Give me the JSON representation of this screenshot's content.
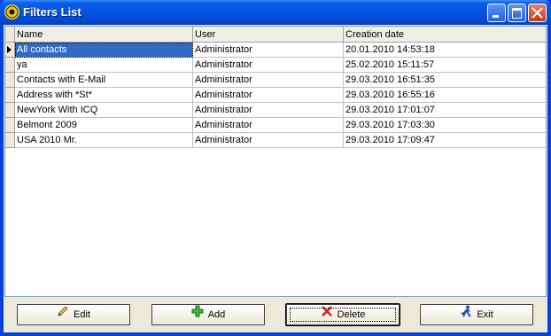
{
  "window": {
    "title": "Filters List"
  },
  "grid": {
    "columns": [
      "Name",
      "User",
      "Creation date"
    ],
    "rows": [
      {
        "name": "All contacts",
        "user": "Administrator",
        "date": "20.01.2010 14:53:18"
      },
      {
        "name": "ya",
        "user": "Administrator",
        "date": "25.02.2010 15:11:57"
      },
      {
        "name": "Contacts with E-Mail",
        "user": "Administrator",
        "date": "29.03.2010 16:51:35"
      },
      {
        "name": "Address with *St*",
        "user": "Administrator",
        "date": "29.03.2010 16:55:16"
      },
      {
        "name": "NewYork With ICQ",
        "user": "Administrator",
        "date": "29.03.2010 17:01:07"
      },
      {
        "name": "Belmont 2009",
        "user": "Administrator",
        "date": "29.03.2010 17:03:30"
      },
      {
        "name": "USA 2010 Mr.",
        "user": "Administrator",
        "date": "29.03.2010 17:09:47"
      }
    ]
  },
  "buttons": {
    "edit": "Edit",
    "add": "Add",
    "delete": "Delete",
    "exit": "Exit"
  },
  "icons": {
    "edit": "pencil-icon",
    "add": "plus-icon",
    "delete": "red-x-icon",
    "exit": "running-man-icon"
  }
}
